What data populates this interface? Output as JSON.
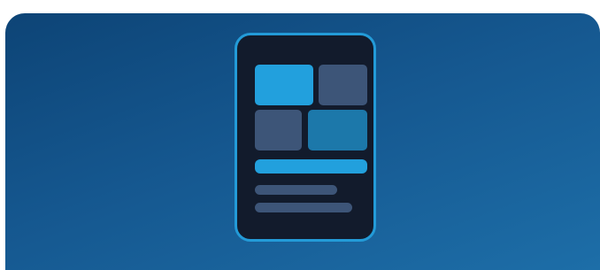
{
  "illustration": {
    "icon": "mobile-dashboard-layout-icon",
    "colors": {
      "background_top": "#0d4476",
      "background_bottom": "#1d6ea8",
      "device_border": "#239bd8",
      "device_screen": "#121b2c",
      "accent": "#22a0dd",
      "muted_tile": "#3d5578",
      "secondary_tile": "#1c78aa",
      "line": "#3d5578"
    }
  }
}
